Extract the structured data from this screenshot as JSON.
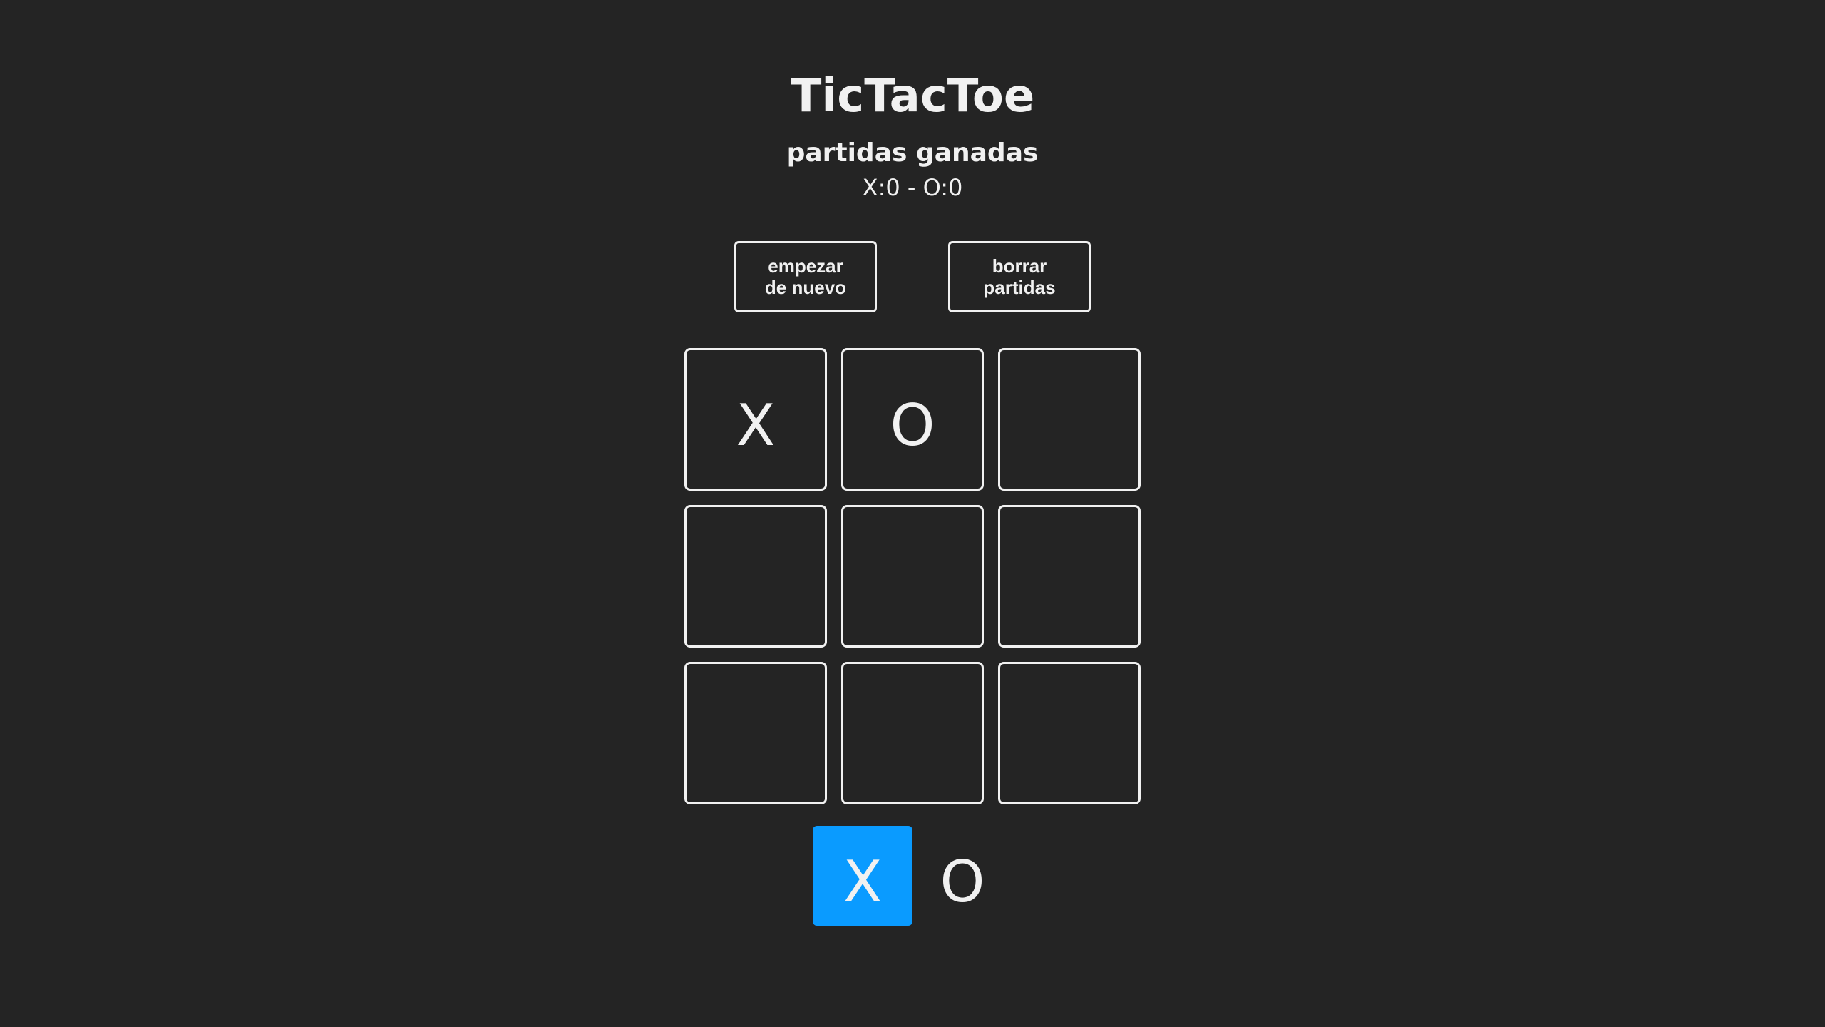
{
  "header": {
    "title": "TicTacToe",
    "subtitle": "partidas ganadas",
    "score": "X:0 - O:0"
  },
  "buttons": {
    "restart_label": "empezar\nde nuevo",
    "clear_label": "borrar\npartidas"
  },
  "board": {
    "cells": [
      "X",
      "O",
      "",
      "",
      "",
      "",
      "",
      "",
      ""
    ]
  },
  "turn": {
    "x_label": "X",
    "o_label": "O",
    "active": "X"
  },
  "colors": {
    "background": "#242424",
    "foreground": "#f1f1f1",
    "active_turn": "#0a9bff"
  }
}
